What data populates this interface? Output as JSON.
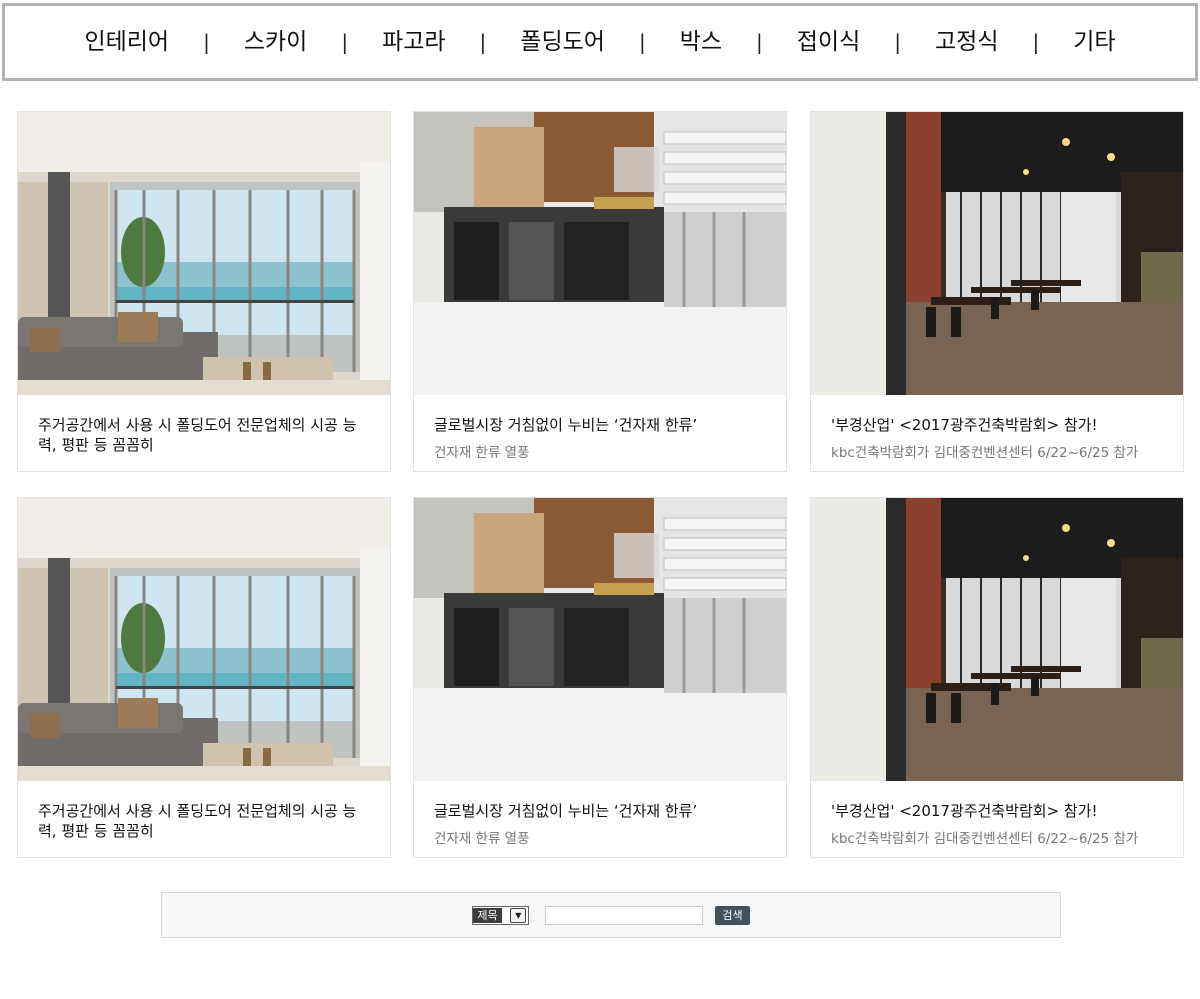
{
  "nav": {
    "items": [
      "인테리어",
      "스카이",
      "파고라",
      "폴딩도어",
      "박스",
      "접이식",
      "고정식",
      "기타"
    ],
    "separator": "|"
  },
  "gallery": {
    "cards": [
      {
        "title": "주거공간에서 사용 시 폴딩도어 전문업체의 시공 능력, 평판 등 꼼꼼히",
        "subtitle": "",
        "image": "living-room-folding-door"
      },
      {
        "title": "글로벌시장 거침없이 누비는 ‘건자재 한류’",
        "subtitle": "건자재 한류 열풍",
        "image": "aluminum-profiles"
      },
      {
        "title": "'부경산업' <2017광주건축박람회> 참가!",
        "subtitle": "kbc건축박람회가 김대중컨벤션센터 6/22~6/25 참가",
        "image": "cafe-interior"
      },
      {
        "title": "주거공간에서 사용 시 폴딩도어 전문업체의 시공 능력, 평판 등 꼼꼼히",
        "subtitle": "",
        "image": "living-room-folding-door"
      },
      {
        "title": "글로벌시장 거침없이 누비는 ‘건자재 한류’",
        "subtitle": "건자재 한류 열풍",
        "image": "aluminum-profiles"
      },
      {
        "title": "'부경산업' <2017광주건축박람회> 참가!",
        "subtitle": "kbc건축박람회가 김대중컨벤션센터 6/22~6/25 참가",
        "image": "cafe-interior"
      }
    ]
  },
  "search": {
    "field_selected": "제목",
    "field_options": [
      "제목"
    ],
    "query_value": "",
    "button_label": "검색"
  }
}
